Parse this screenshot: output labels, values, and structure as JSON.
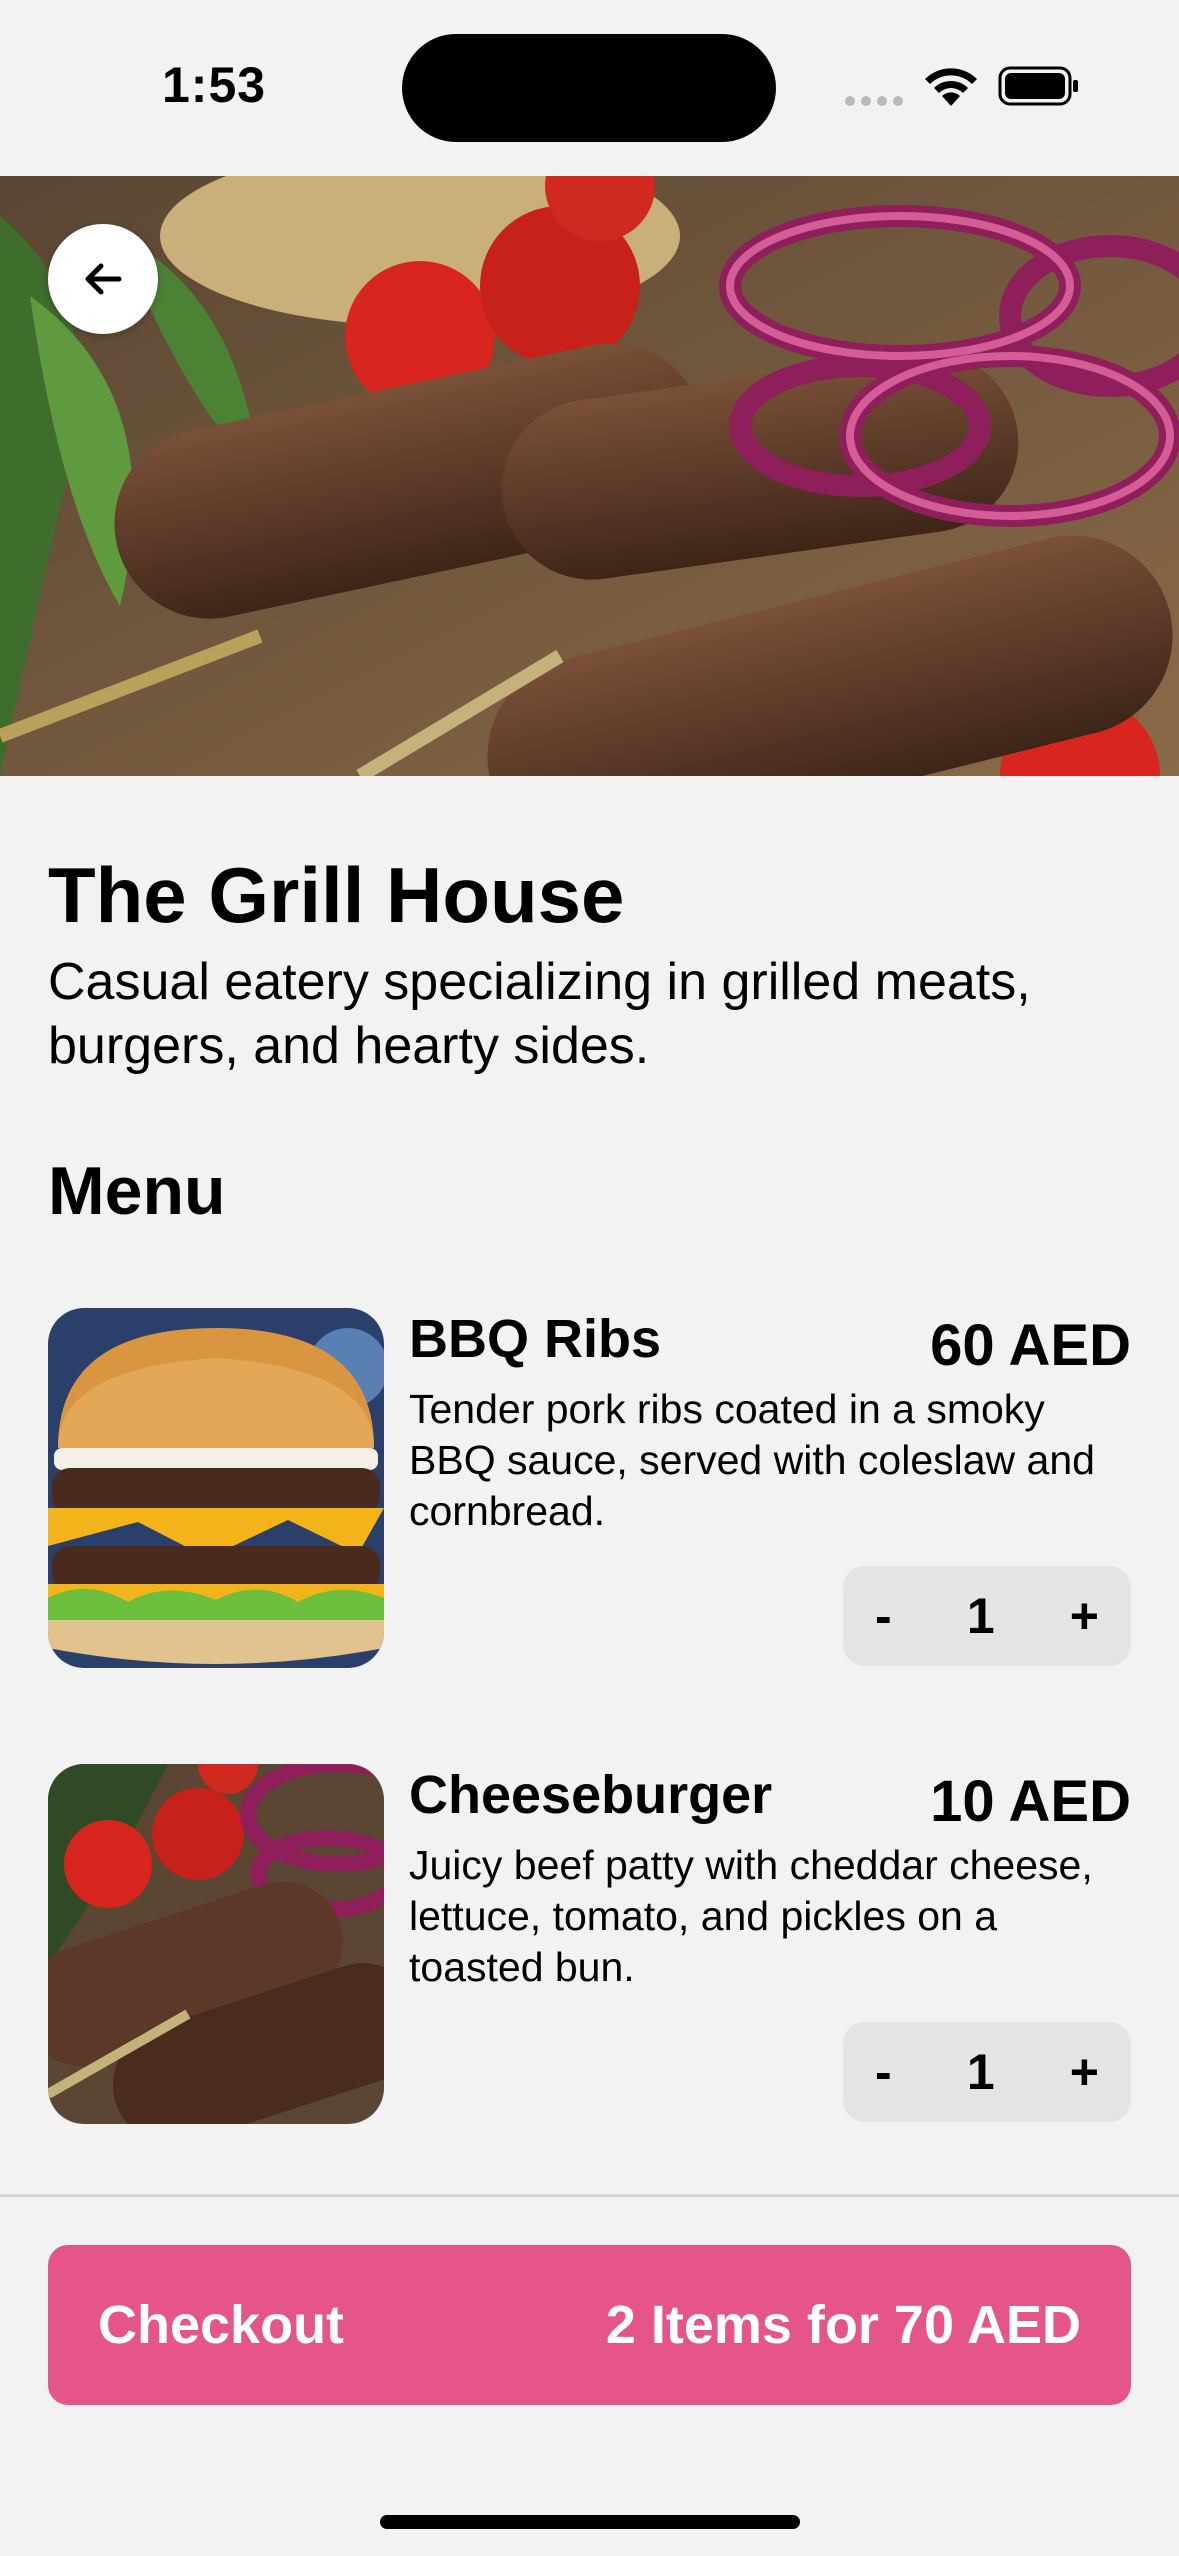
{
  "status_bar": {
    "time": "1:53"
  },
  "hero": {
    "image": "grilled-kebab-skewers-photo",
    "back_icon": "arrow-left-icon"
  },
  "restaurant": {
    "name": "The Grill House",
    "description": "Casual eatery specializing in grilled meats, burgers, and hearty sides."
  },
  "menu": {
    "heading": "Menu",
    "items": [
      {
        "name": "BBQ Ribs",
        "price": "60 AED",
        "description": "Tender pork ribs coated in a smoky BBQ sauce, served with coleslaw and cornbread.",
        "quantity": "1",
        "minus": "-",
        "plus": "+",
        "image": "cheeseburger-photo"
      },
      {
        "name": "Cheeseburger",
        "price": "10 AED",
        "description": "Juicy beef patty with cheddar cheese, lettuce, tomato, and pickles on a toasted bun.",
        "quantity": "1",
        "minus": "-",
        "plus": "+",
        "image": "kebab-skewers-photo"
      }
    ]
  },
  "checkout": {
    "label": "Checkout",
    "summary": "2 Items for 70 AED"
  },
  "colors": {
    "accent": "#e6558a",
    "background": "#f2f2f2",
    "stepper": "#e4e4e4"
  }
}
